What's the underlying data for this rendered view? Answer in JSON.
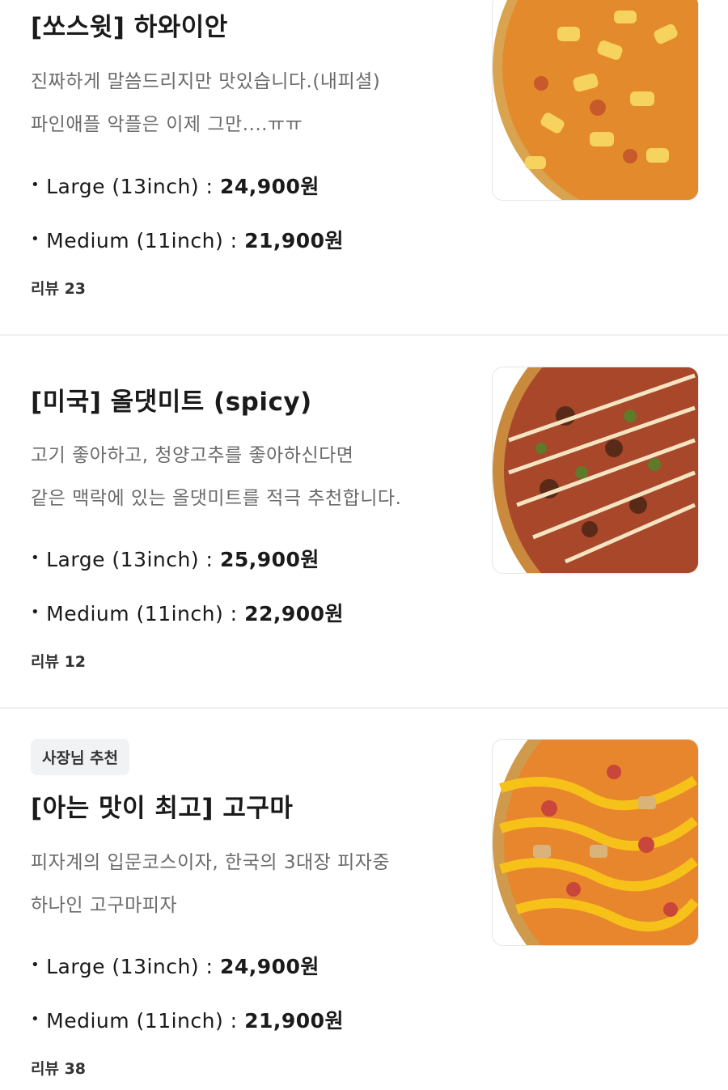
{
  "items": [
    {
      "title": "[쏘스윗] 하와이안",
      "desc": [
        "진짜하게 말씀드리지만 맛있습니다.(내피셜)",
        "파인애플 악플은 이제 그만....ㅠㅠ"
      ],
      "prices": [
        {
          "label": "Large (13inch) : ",
          "amount": "24,900원"
        },
        {
          "label": "Medium (11inch) : ",
          "amount": "21,900원"
        }
      ],
      "review": "리뷰 23",
      "image": "hawaiian-pizza-image"
    },
    {
      "title": "[미국] 올댓미트 (spicy)",
      "desc": [
        "고기 좋아하고, 청양고추를 좋아하신다면",
        "같은 맥락에 있는 올댓미트를 적극 추천합니다."
      ],
      "prices": [
        {
          "label": "Large (13inch) : ",
          "amount": "25,900원"
        },
        {
          "label": "Medium (11inch) : ",
          "amount": "22,900원"
        }
      ],
      "review": "리뷰 12",
      "image": "all-that-meat-pizza-image"
    },
    {
      "badge": "사장님 추천",
      "title": "[아는 맛이 최고] 고구마",
      "desc": [
        "피자계의 입문코스이자, 한국의 3대장 피자중",
        "하나인 고구마피자"
      ],
      "prices": [
        {
          "label": "Large (13inch) : ",
          "amount": "24,900원"
        },
        {
          "label": "Medium (11inch) : ",
          "amount": "21,900원"
        }
      ],
      "review": "리뷰 38",
      "image": "sweet-potato-pizza-image"
    }
  ]
}
